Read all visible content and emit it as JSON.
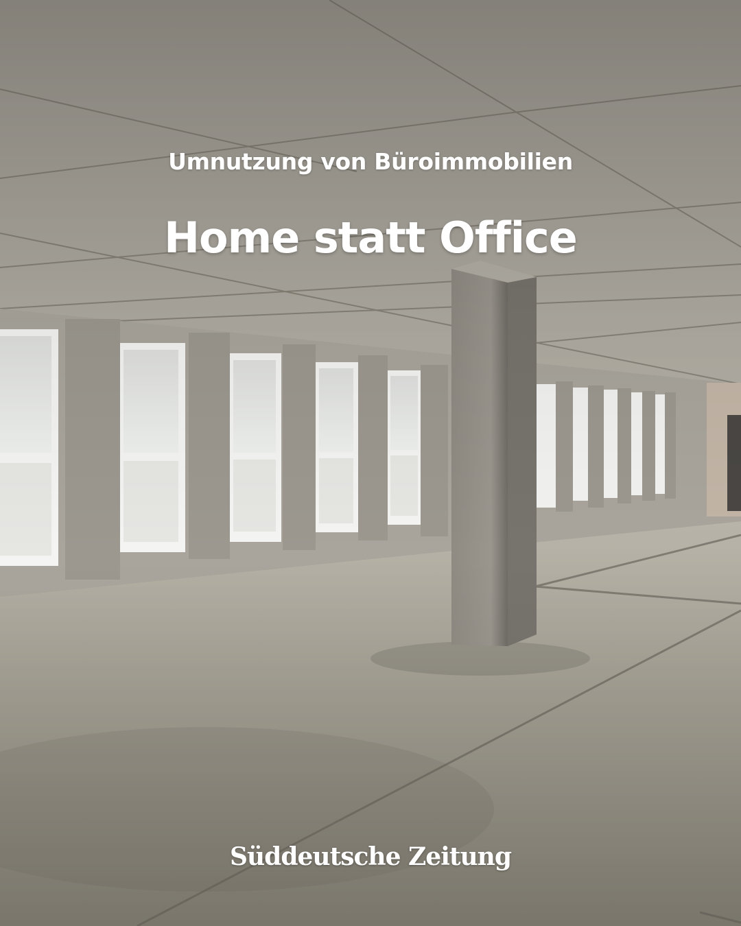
{
  "kicker": "Umnutzung von Büroimmobilien",
  "headline": "Home statt Office",
  "brand": "Süddeutsche Zeitung",
  "photo": {
    "subject": "empty-concrete-office-floor",
    "colors": {
      "ceiling": "#a29e95",
      "floor": "#9d998e",
      "column": "#8e8a82",
      "window": "#e9ebea"
    }
  }
}
